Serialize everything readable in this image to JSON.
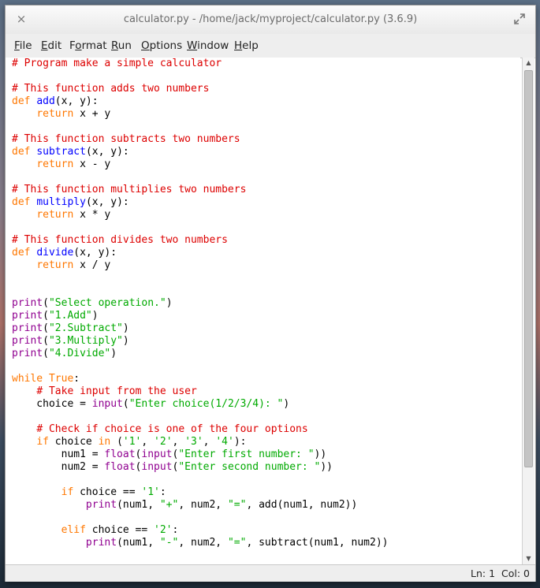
{
  "window": {
    "title": "calculator.py - /home/jack/myproject/calculator.py (3.6.9)",
    "close_glyph": "×"
  },
  "menu": [
    {
      "label_underlined": "F",
      "label_rest": "ile"
    },
    {
      "label_underlined": "E",
      "label_rest": "dit"
    },
    {
      "label_prefix": "F",
      "label_underlined": "o",
      "label_rest": "rmat"
    },
    {
      "label_underlined": "R",
      "label_rest": "un"
    },
    {
      "label_underlined": "O",
      "label_rest": "ptions"
    },
    {
      "label_underlined": "W",
      "label_rest": "indow"
    },
    {
      "label_underlined": "H",
      "label_rest": "elp"
    }
  ],
  "code_lines": [
    [
      {
        "t": "c",
        "v": "# Program make a simple calculator"
      }
    ],
    [],
    [
      {
        "t": "c",
        "v": "# This function adds two numbers"
      }
    ],
    [
      {
        "t": "k",
        "v": "def "
      },
      {
        "t": "f",
        "v": "add"
      },
      {
        "t": "n",
        "v": "(x, y):"
      }
    ],
    [
      {
        "t": "n",
        "v": "    "
      },
      {
        "t": "k",
        "v": "return"
      },
      {
        "t": "n",
        "v": " x + y"
      }
    ],
    [],
    [
      {
        "t": "c",
        "v": "# This function subtracts two numbers"
      }
    ],
    [
      {
        "t": "k",
        "v": "def "
      },
      {
        "t": "f",
        "v": "subtract"
      },
      {
        "t": "n",
        "v": "(x, y):"
      }
    ],
    [
      {
        "t": "n",
        "v": "    "
      },
      {
        "t": "k",
        "v": "return"
      },
      {
        "t": "n",
        "v": " x - y"
      }
    ],
    [],
    [
      {
        "t": "c",
        "v": "# This function multiplies two numbers"
      }
    ],
    [
      {
        "t": "k",
        "v": "def "
      },
      {
        "t": "f",
        "v": "multiply"
      },
      {
        "t": "n",
        "v": "(x, y):"
      }
    ],
    [
      {
        "t": "n",
        "v": "    "
      },
      {
        "t": "k",
        "v": "return"
      },
      {
        "t": "n",
        "v": " x * y"
      }
    ],
    [],
    [
      {
        "t": "c",
        "v": "# This function divides two numbers"
      }
    ],
    [
      {
        "t": "k",
        "v": "def "
      },
      {
        "t": "f",
        "v": "divide"
      },
      {
        "t": "n",
        "v": "(x, y):"
      }
    ],
    [
      {
        "t": "n",
        "v": "    "
      },
      {
        "t": "k",
        "v": "return"
      },
      {
        "t": "n",
        "v": " x / y"
      }
    ],
    [],
    [],
    [
      {
        "t": "b",
        "v": "print"
      },
      {
        "t": "n",
        "v": "("
      },
      {
        "t": "s",
        "v": "\"Select operation.\""
      },
      {
        "t": "n",
        "v": ")"
      }
    ],
    [
      {
        "t": "b",
        "v": "print"
      },
      {
        "t": "n",
        "v": "("
      },
      {
        "t": "s",
        "v": "\"1.Add\""
      },
      {
        "t": "n",
        "v": ")"
      }
    ],
    [
      {
        "t": "b",
        "v": "print"
      },
      {
        "t": "n",
        "v": "("
      },
      {
        "t": "s",
        "v": "\"2.Subtract\""
      },
      {
        "t": "n",
        "v": ")"
      }
    ],
    [
      {
        "t": "b",
        "v": "print"
      },
      {
        "t": "n",
        "v": "("
      },
      {
        "t": "s",
        "v": "\"3.Multiply\""
      },
      {
        "t": "n",
        "v": ")"
      }
    ],
    [
      {
        "t": "b",
        "v": "print"
      },
      {
        "t": "n",
        "v": "("
      },
      {
        "t": "s",
        "v": "\"4.Divide\""
      },
      {
        "t": "n",
        "v": ")"
      }
    ],
    [],
    [
      {
        "t": "k",
        "v": "while"
      },
      {
        "t": "n",
        "v": " "
      },
      {
        "t": "k",
        "v": "True"
      },
      {
        "t": "n",
        "v": ":"
      }
    ],
    [
      {
        "t": "n",
        "v": "    "
      },
      {
        "t": "c",
        "v": "# Take input from the user"
      }
    ],
    [
      {
        "t": "n",
        "v": "    choice = "
      },
      {
        "t": "b",
        "v": "input"
      },
      {
        "t": "n",
        "v": "("
      },
      {
        "t": "s",
        "v": "\"Enter choice(1/2/3/4): \""
      },
      {
        "t": "n",
        "v": ")"
      }
    ],
    [],
    [
      {
        "t": "n",
        "v": "    "
      },
      {
        "t": "c",
        "v": "# Check if choice is one of the four options"
      }
    ],
    [
      {
        "t": "n",
        "v": "    "
      },
      {
        "t": "k",
        "v": "if"
      },
      {
        "t": "n",
        "v": " choice "
      },
      {
        "t": "k",
        "v": "in"
      },
      {
        "t": "n",
        "v": " ("
      },
      {
        "t": "s",
        "v": "'1'"
      },
      {
        "t": "n",
        "v": ", "
      },
      {
        "t": "s",
        "v": "'2'"
      },
      {
        "t": "n",
        "v": ", "
      },
      {
        "t": "s",
        "v": "'3'"
      },
      {
        "t": "n",
        "v": ", "
      },
      {
        "t": "s",
        "v": "'4'"
      },
      {
        "t": "n",
        "v": "):"
      }
    ],
    [
      {
        "t": "n",
        "v": "        num1 = "
      },
      {
        "t": "b",
        "v": "float"
      },
      {
        "t": "n",
        "v": "("
      },
      {
        "t": "b",
        "v": "input"
      },
      {
        "t": "n",
        "v": "("
      },
      {
        "t": "s",
        "v": "\"Enter first number: \""
      },
      {
        "t": "n",
        "v": "))"
      }
    ],
    [
      {
        "t": "n",
        "v": "        num2 = "
      },
      {
        "t": "b",
        "v": "float"
      },
      {
        "t": "n",
        "v": "("
      },
      {
        "t": "b",
        "v": "input"
      },
      {
        "t": "n",
        "v": "("
      },
      {
        "t": "s",
        "v": "\"Enter second number: \""
      },
      {
        "t": "n",
        "v": "))"
      }
    ],
    [],
    [
      {
        "t": "n",
        "v": "        "
      },
      {
        "t": "k",
        "v": "if"
      },
      {
        "t": "n",
        "v": " choice == "
      },
      {
        "t": "s",
        "v": "'1'"
      },
      {
        "t": "n",
        "v": ":"
      }
    ],
    [
      {
        "t": "n",
        "v": "            "
      },
      {
        "t": "b",
        "v": "print"
      },
      {
        "t": "n",
        "v": "(num1, "
      },
      {
        "t": "s",
        "v": "\"+\""
      },
      {
        "t": "n",
        "v": ", num2, "
      },
      {
        "t": "s",
        "v": "\"=\""
      },
      {
        "t": "n",
        "v": ", add(num1, num2))"
      }
    ],
    [],
    [
      {
        "t": "n",
        "v": "        "
      },
      {
        "t": "k",
        "v": "elif"
      },
      {
        "t": "n",
        "v": " choice == "
      },
      {
        "t": "s",
        "v": "'2'"
      },
      {
        "t": "n",
        "v": ":"
      }
    ],
    [
      {
        "t": "n",
        "v": "            "
      },
      {
        "t": "b",
        "v": "print"
      },
      {
        "t": "n",
        "v": "(num1, "
      },
      {
        "t": "s",
        "v": "\"-\""
      },
      {
        "t": "n",
        "v": ", num2, "
      },
      {
        "t": "s",
        "v": "\"=\""
      },
      {
        "t": "n",
        "v": ", subtract(num1, num2))"
      }
    ]
  ],
  "status": {
    "line": "Ln: 1",
    "col": "Col: 0"
  },
  "colors": {
    "comment": "#dd0000",
    "keyword": "#ff7700",
    "function_name": "#0000ff",
    "builtin": "#900090",
    "string": "#00aa00"
  },
  "icons": {
    "close": "close-icon",
    "maximize": "maximize-icon"
  }
}
